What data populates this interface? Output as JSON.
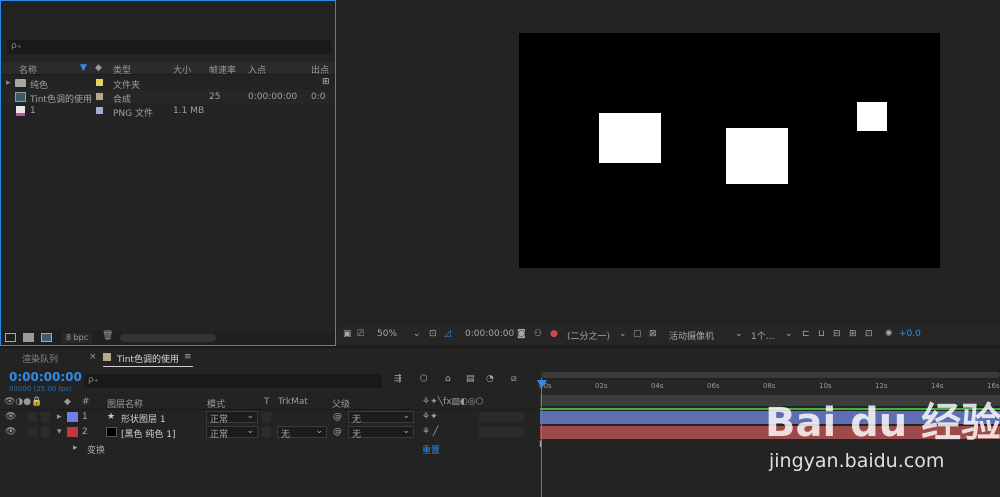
{
  "project": {
    "columns": {
      "name": "名称",
      "type": "类型",
      "size": "大小",
      "fps": "帧速率",
      "in": "入点",
      "out": "出点"
    },
    "items": [
      {
        "name": "纯色",
        "type": "文件夹",
        "size": "",
        "fps": "",
        "in": "",
        "out": "",
        "tag_color": "#e3d35c"
      },
      {
        "name": "Tint色调的使用",
        "type": "合成",
        "size": "",
        "fps": "25",
        "in": "0:00:00:00",
        "out": "0:0",
        "tag_color": "#b7a78f"
      },
      {
        "name": "1",
        "type": "PNG 文件",
        "size": "1.1 MB",
        "fps": "",
        "in": "",
        "out": "",
        "tag_color": "#a9a9d6"
      }
    ],
    "bpc": "8 bpc"
  },
  "viewer": {
    "zoom": "50%",
    "timecode": "0:00:00:00",
    "resolution": "(二分之一)",
    "camera": "活动摄像机",
    "views": "1个...",
    "exposure": "+0.0"
  },
  "timeline": {
    "tab_render": "渲染队列",
    "tab_comp": "Tint色调的使用",
    "current_time": "0:00:00:00",
    "frame_info": "00000 (25.00 fps)",
    "search_placeholder": "ρ₊",
    "columns": {
      "num": "#",
      "layer_name": "图层名称",
      "mode": "模式",
      "t": "T",
      "trkmat": "TrkMat",
      "parent": "父级"
    },
    "layers": [
      {
        "num": "1",
        "name": "形状图层 1",
        "mode": "正常",
        "trkmat": "",
        "parent": "无",
        "label_color": "#6f7fe6",
        "bar_color": "#5f6db1"
      },
      {
        "num": "2",
        "name": "[黑色 纯色 1]",
        "mode": "正常",
        "trkmat": "无",
        "parent": "无",
        "label_color": "#c23a3a",
        "bar_color": "#9e4a4a"
      }
    ],
    "transform_label": "变换",
    "reset_label": "重置",
    "ruler_ticks": [
      "00s",
      "02s",
      "04s",
      "06s",
      "08s",
      "10s",
      "12s",
      "14s",
      "16s"
    ],
    "accent": "#2d8ceb"
  },
  "watermark": {
    "brand": "Bai du 经验",
    "url": "jingyan.baidu.com"
  }
}
